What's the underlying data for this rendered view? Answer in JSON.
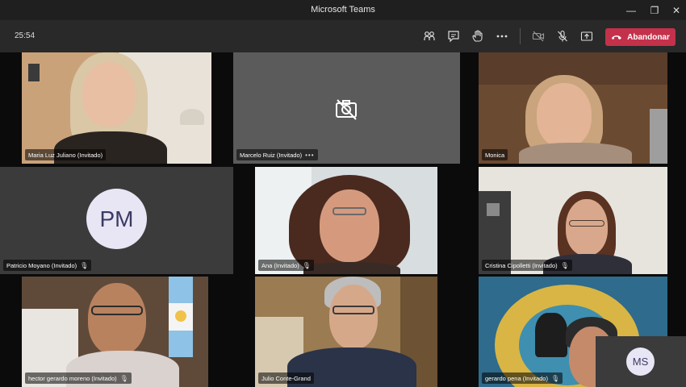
{
  "window": {
    "title": "Microsoft Teams"
  },
  "toolbar": {
    "timer": "25:54",
    "leave_label": "Abandonar",
    "icons": [
      "people-icon",
      "chat-icon",
      "raise-hand-icon",
      "more-icon",
      "camera-off-icon",
      "mic-off-icon",
      "share-icon"
    ]
  },
  "participants": [
    {
      "name": "Maria Luz Juliano (Invitado)",
      "video": true
    },
    {
      "name": "Marcelo Ruiz (Invitado)",
      "video": false,
      "camera_off_icon": true,
      "more": "•••"
    },
    {
      "name": "Monica",
      "video": true
    },
    {
      "name": "Patricio Moyano (Invitado)",
      "video": false,
      "initials": "PM",
      "muted": true
    },
    {
      "name": "Ana (Invitado)",
      "video": true,
      "muted": true
    },
    {
      "name": "Cristina Cipolletti (Invitado)",
      "video": true,
      "muted": true
    },
    {
      "name": "hector gerardo moreno (Invitado)",
      "video": true,
      "muted": true
    },
    {
      "name": "Julio Conte-Grand",
      "video": true
    },
    {
      "name": "gerardo pena (Invitado)",
      "video": true,
      "muted": true
    }
  ],
  "self_view": {
    "initials": "MS"
  },
  "colors": {
    "leave": "#c4314b",
    "avatar_bg": "#e8e6f4",
    "tile_gray": "#5b5b5b"
  }
}
